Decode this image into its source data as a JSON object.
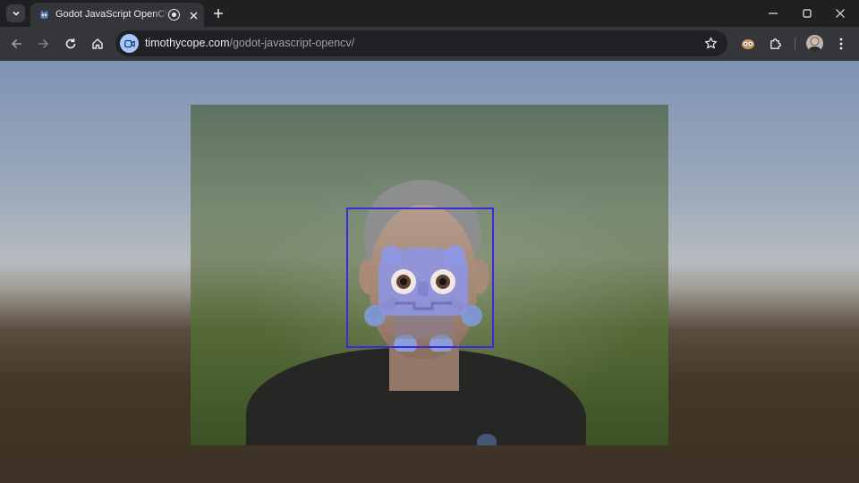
{
  "browser": {
    "tab": {
      "title": "Godot JavaScript OpenCV (",
      "favicon": "godot-icon",
      "recording_indicator": "recording-icon"
    },
    "window_controls": [
      "minimize-icon",
      "maximize-icon",
      "close-icon"
    ],
    "address_bar": {
      "host": "timothycope.com",
      "path": "/godot-javascript-opencv/",
      "site_chip_icon": "camera-icon"
    },
    "colors": {
      "accent": "#a8c7fa",
      "toolbar": "#35363a",
      "tabstrip": "#1f2022"
    }
  },
  "scene": {
    "overlay": "godot-robot-mask",
    "face_detection_box_color": "#3b28e0"
  }
}
